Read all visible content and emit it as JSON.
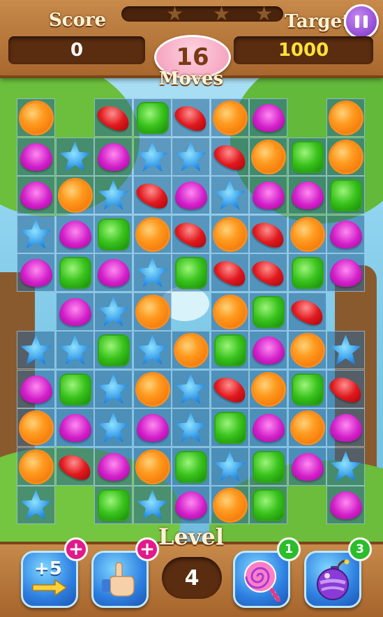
{
  "header": {
    "score_label": "Score",
    "target_label": "Target",
    "score_value": "0",
    "target_value": "1000",
    "moves_count": "16",
    "moves_label": "Moves",
    "stars_earned": 0,
    "stars_total": 3,
    "progress_fraction": 0
  },
  "board": {
    "rows": [
      [
        "orange",
        "",
        "red",
        "green",
        "red",
        "orange",
        "heart",
        "",
        "orange"
      ],
      [
        "heart",
        "blue",
        "heart",
        "blue",
        "blue",
        "red",
        "orange",
        "green",
        "orange"
      ],
      [
        "heart",
        "orange",
        "blue",
        "red",
        "heart",
        "blue",
        "heart",
        "heart",
        "green"
      ],
      [
        "blue",
        "heart",
        "green",
        "orange",
        "red",
        "orange",
        "red",
        "orange",
        "heart"
      ],
      [
        "heart",
        "green",
        "heart",
        "blue",
        "green",
        "red",
        "red",
        "green",
        "heart"
      ],
      [
        "",
        "heart",
        "blue",
        "orange",
        "",
        "orange",
        "green",
        "red",
        ""
      ],
      [
        "blue",
        "blue",
        "green",
        "blue",
        "orange",
        "green",
        "heart",
        "orange",
        "blue"
      ],
      [
        "heart",
        "green",
        "blue",
        "orange",
        "blue",
        "red",
        "orange",
        "green",
        "red"
      ],
      [
        "orange",
        "heart",
        "blue",
        "heart",
        "blue",
        "green",
        "heart",
        "orange",
        "heart"
      ],
      [
        "orange",
        "red",
        "heart",
        "orange",
        "green",
        "blue",
        "green",
        "heart",
        "blue"
      ],
      [
        "blue",
        "",
        "green",
        "blue",
        "heart",
        "orange",
        "green",
        "",
        "heart"
      ]
    ],
    "empty_cells": [
      [
        0,
        1
      ],
      [
        0,
        7
      ],
      [
        5,
        0
      ],
      [
        5,
        4
      ],
      [
        5,
        8
      ],
      [
        10,
        1
      ],
      [
        10,
        7
      ]
    ]
  },
  "footer": {
    "level_label": "Level",
    "level_value": "4",
    "boosters": [
      {
        "name": "extra-moves",
        "label": "+5",
        "badge": "+"
      },
      {
        "name": "hand",
        "label": "",
        "badge": "+"
      },
      {
        "name": "lollipop",
        "label": "",
        "badge": "1"
      },
      {
        "name": "bomb",
        "label": "",
        "badge": "3"
      }
    ]
  },
  "colors": {
    "wood": "#b5743a",
    "panel": "#5a2c10",
    "target_text": "#ffe23a",
    "pause": "#7b2fc4",
    "plus_badge": "#e21a8a",
    "count_badge": "#2bbd2b"
  }
}
